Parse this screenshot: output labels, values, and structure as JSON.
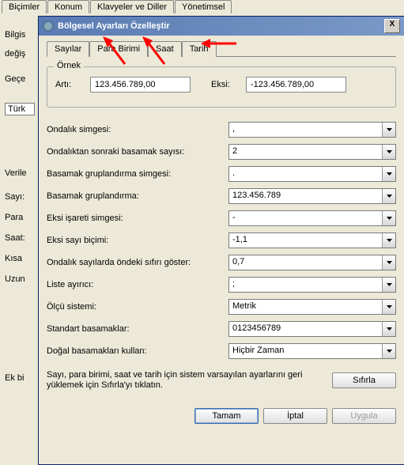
{
  "outer_tabs": {
    "bicimler": "Biçimler",
    "konum": "Konum",
    "klavyeler": "Klavyeler ve Diller",
    "yonetimsel": "Yönetimsel"
  },
  "bg": {
    "bilgis": "Bilgis",
    "degis": "değiş",
    "gece": "Geçe",
    "turk": "Türk",
    "verile": "Verile",
    "sayi": "Sayı:",
    "para": "Para",
    "saat": "Saat:",
    "kisa": "Kısa",
    "uzun": "Uzun",
    "ekbi": "Ek bi"
  },
  "dialog": {
    "title": "Bölgesel Ayarları Özelleştir",
    "close": "X"
  },
  "inner_tabs": {
    "sayilar": "Sayılar",
    "para": "Para Birimi",
    "saat": "Saat",
    "tarih": "Tarih"
  },
  "example": {
    "legend": "Örnek",
    "arti_label": "Artı:",
    "arti_value": "123.456.789,00",
    "eksi_label": "Eksi:",
    "eksi_value": "-123.456.789,00"
  },
  "settings": {
    "ondalik_simgesi": {
      "label": "Ondalık simgesi:",
      "value": ","
    },
    "ondalik_basamak": {
      "label": "Ondalıktan sonraki basamak sayısı:",
      "value": "2"
    },
    "basamak_simgesi": {
      "label": "Basamak gruplandırma simgesi:",
      "value": "."
    },
    "basamak_grup": {
      "label": "Basamak gruplandırma:",
      "value": "123.456.789"
    },
    "eksi_isaret": {
      "label": "Eksi işareti simgesi:",
      "value": "-"
    },
    "eksi_bicim": {
      "label": "Eksi sayı biçimi:",
      "value": "-1,1"
    },
    "sifir_goster": {
      "label": "Ondalık sayılarda öndeki sıfırı göster:",
      "value": "0,7"
    },
    "liste_ayirici": {
      "label": "Liste ayırıcı:",
      "value": ";"
    },
    "olcu_sistemi": {
      "label": "Ölçü sistemi:",
      "value": "Metrik"
    },
    "standart_basamak": {
      "label": "Standart basamaklar:",
      "value": "0123456789"
    },
    "dogal_basamak": {
      "label": "Doğal basamakları kullan:",
      "value": "Hiçbir Zaman"
    }
  },
  "footer": {
    "note": "Sayı, para birimi, saat ve tarih için sistem varsayılan ayarlarını geri yüklemek için Sıfırla'yı tıklatın.",
    "reset": "Sıfırla"
  },
  "buttons": {
    "tamam": "Tamam",
    "iptal": "İptal",
    "uygula": "Uygula"
  }
}
